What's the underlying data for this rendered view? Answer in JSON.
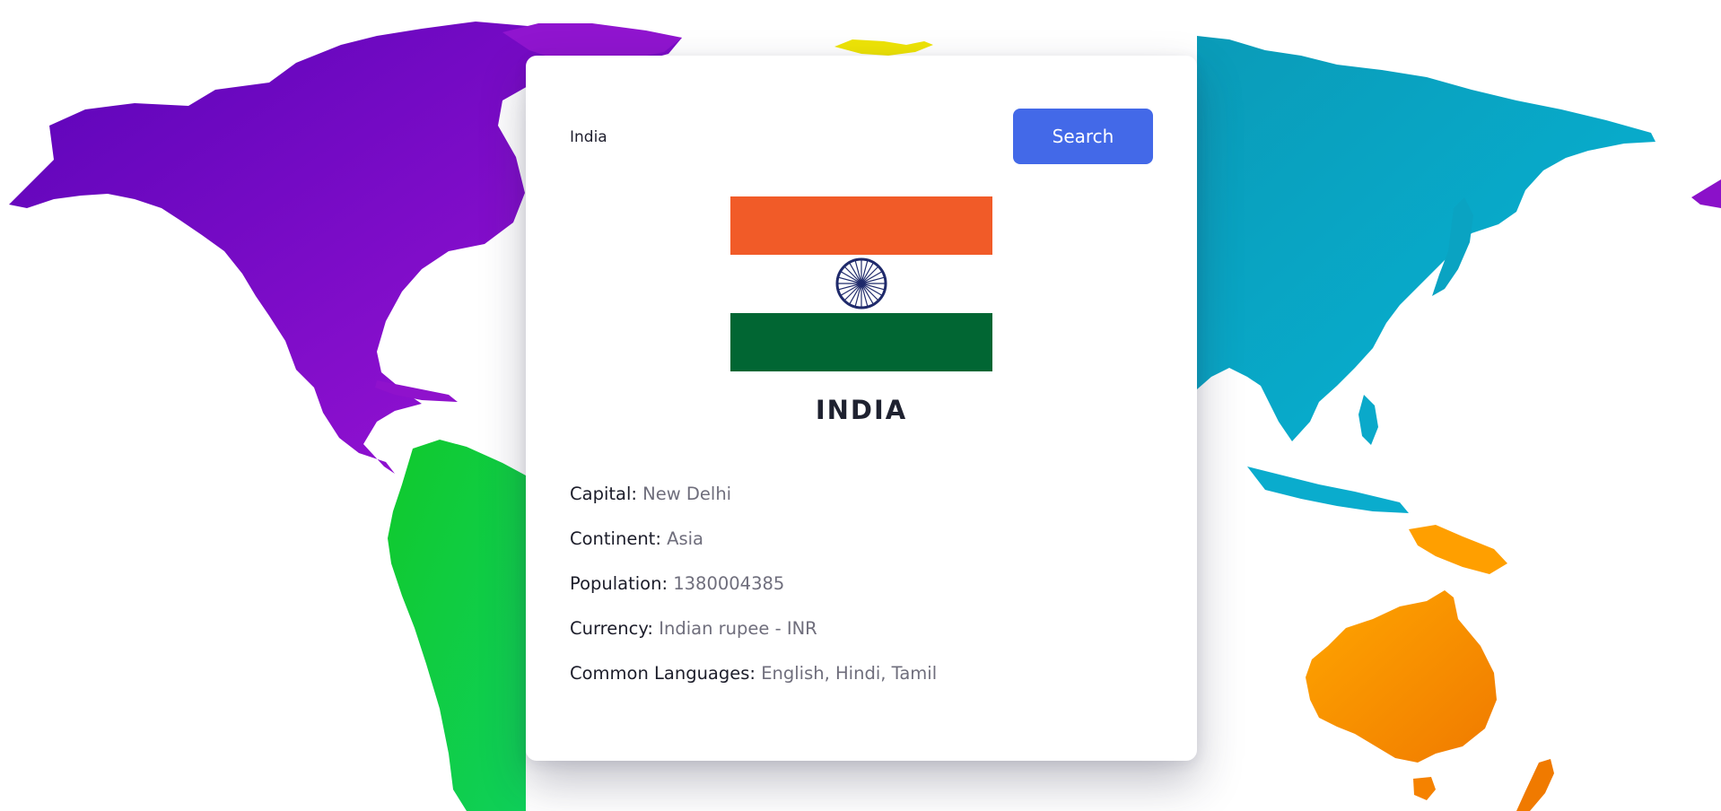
{
  "colors": {
    "accent": "#4369e8",
    "flag_saffron": "#f15b28",
    "flag_white": "#ffffff",
    "flag_green": "#016633",
    "chakra_blue": "#1f2a6b",
    "north_america": "#8a10c9",
    "south_america": "#12cd3b",
    "europe": "#eae203",
    "asia": "#09a7c6",
    "oceania": "#ff9500"
  },
  "search": {
    "value": "India",
    "placeholder": "",
    "button_label": "Search"
  },
  "country": {
    "flag_icon": "india-flag-icon",
    "name": "INDIA",
    "details": [
      {
        "label": "Capital:",
        "value": "New Delhi"
      },
      {
        "label": "Continent:",
        "value": "Asia"
      },
      {
        "label": "Population:",
        "value": "1380004385"
      },
      {
        "label": "Currency:",
        "value": "Indian rupee - INR"
      },
      {
        "label": "Common Languages:",
        "value": "English, Hindi, Tamil"
      }
    ]
  }
}
